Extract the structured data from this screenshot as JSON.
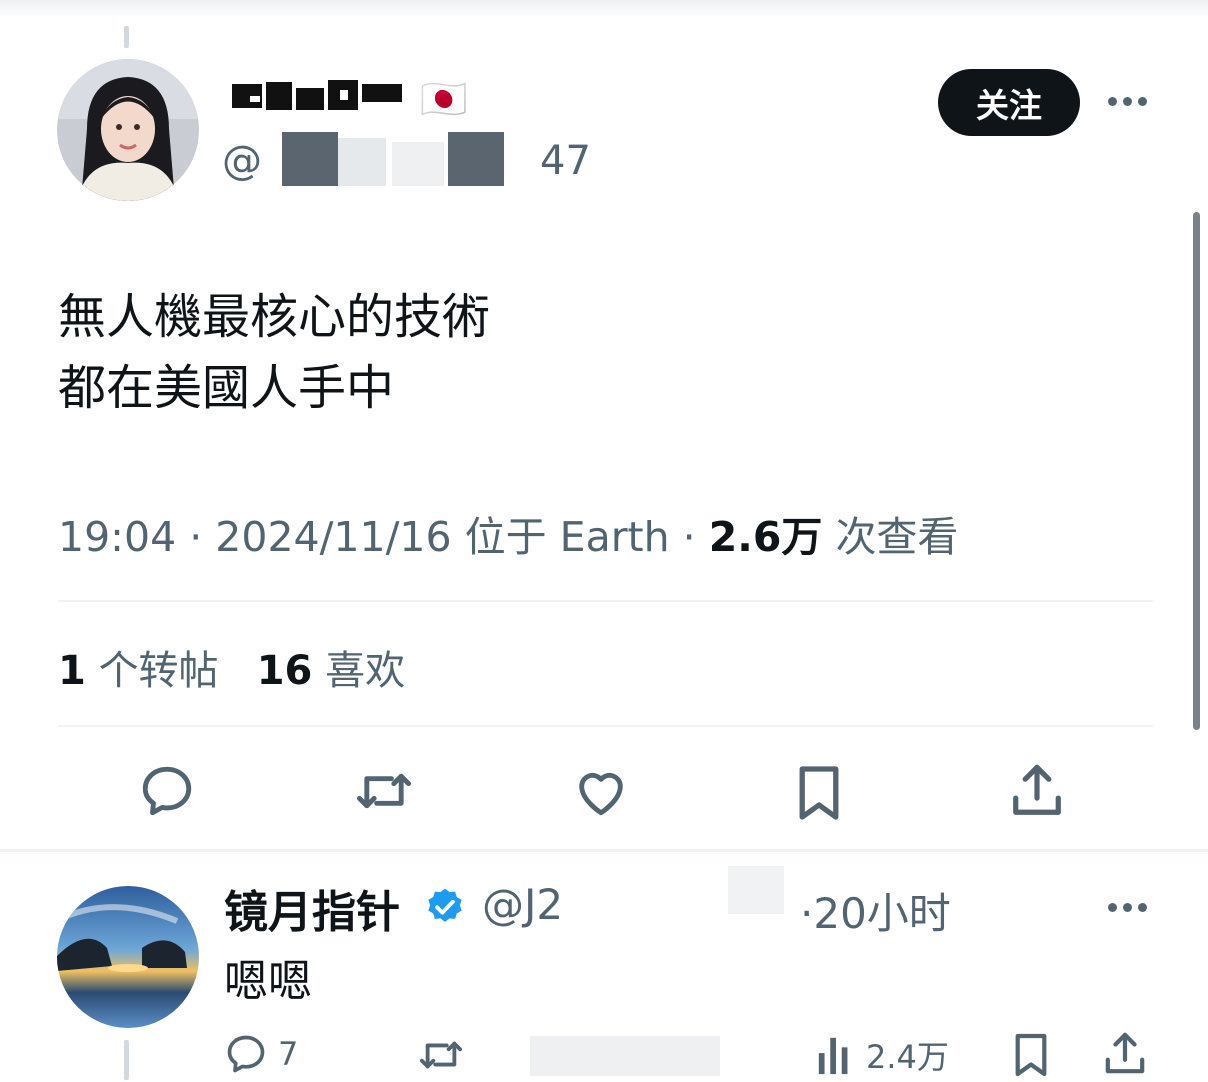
{
  "tweet": {
    "author_name": "",
    "flag": "🇯🇵",
    "handle_suffix": "47",
    "follow_label": "关注",
    "text_line1": "無人機最核心的技術",
    "text_line2": "都在美國人手中",
    "time": "19:04",
    "date": "2024/11/16",
    "location": "位于 Earth",
    "views_count": "2.6万",
    "views_label": "次查看",
    "reposts_count": "1",
    "reposts_label": "个转帖",
    "likes_count": "16",
    "likes_label": "喜欢"
  },
  "reply": {
    "author_name": "镜月指针",
    "handle": "@J2",
    "time": "·20小时",
    "text": "嗯嗯",
    "reply_count": "7",
    "views_count": "2.4万"
  },
  "icons": [
    "reply-icon",
    "repost-icon",
    "like-icon",
    "bookmark-icon",
    "share-icon",
    "verified-badge-icon",
    "views-icon",
    "more-icon"
  ],
  "colors": {
    "verified": "#1d9bf0",
    "text": "#0f1419",
    "muted": "#536471",
    "follow_bg": "#0f1419"
  }
}
